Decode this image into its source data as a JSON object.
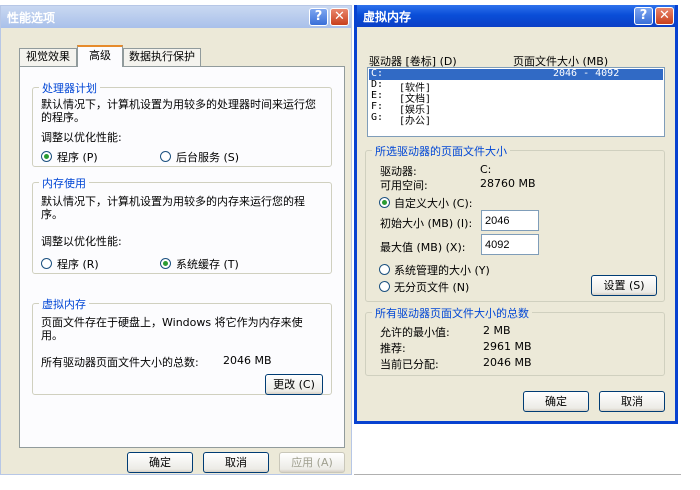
{
  "perf": {
    "title": "性能选项",
    "tabs": [
      "视觉效果",
      "高级",
      "数据执行保护"
    ],
    "cpu": {
      "legend": "处理器计划",
      "desc": "默认情况下，计算机设置为用较多的处理器时间来运行您的程序。",
      "adjust": "调整以优化性能:",
      "opt1": "程序 (P)",
      "opt2": "后台服务 (S)"
    },
    "mem": {
      "legend": "内存使用",
      "desc": "默认情况下，计算机设置为用较多的内存来运行您的程序。",
      "adjust": "调整以优化性能:",
      "opt1": "程序 (R)",
      "opt2": "系统缓存 (T)"
    },
    "vm": {
      "legend": "虚拟内存",
      "desc": "页面文件存在于硬盘上，Windows 将它作为内存来使用。",
      "total_label": "所有驱动器页面文件大小的总数:",
      "total_value": "2046 MB",
      "change_btn": "更改 (C)"
    },
    "ok": "确定",
    "cancel": "取消",
    "apply": "应用 (A)"
  },
  "vmwin": {
    "title": "虚拟内存",
    "col_drive": "驱动器 [卷标] (D)",
    "col_size": "页面文件大小 (MB)",
    "drives": [
      {
        "letter": "C:",
        "label": "",
        "size": "2046 - 4092"
      },
      {
        "letter": "D:",
        "label": "[软件]",
        "size": ""
      },
      {
        "letter": "E:",
        "label": "[文档]",
        "size": ""
      },
      {
        "letter": "F:",
        "label": "[娱乐]",
        "size": ""
      },
      {
        "letter": "G:",
        "label": "[办公]",
        "size": ""
      }
    ],
    "sel": {
      "legend": "所选驱动器的页面文件大小",
      "drive_label": "驱动器:",
      "drive_value": "C:",
      "space_label": "可用空间:",
      "space_value": "28760 MB",
      "custom": "自定义大小 (C):",
      "initial_label": "初始大小 (MB) (I):",
      "initial_value": "2046",
      "max_label": "最大值 (MB) (X):",
      "max_value": "4092",
      "system_managed": "系统管理的大小 (Y)",
      "no_paging": "无分页文件 (N)",
      "set_btn": "设置 (S)"
    },
    "all": {
      "legend": "所有驱动器页面文件大小的总数",
      "min_label": "允许的最小值:",
      "min_value": "2 MB",
      "rec_label": "推荐:",
      "rec_value": "2961 MB",
      "cur_label": "当前已分配:",
      "cur_value": "2046 MB"
    },
    "ok": "确定",
    "cancel": "取消"
  }
}
